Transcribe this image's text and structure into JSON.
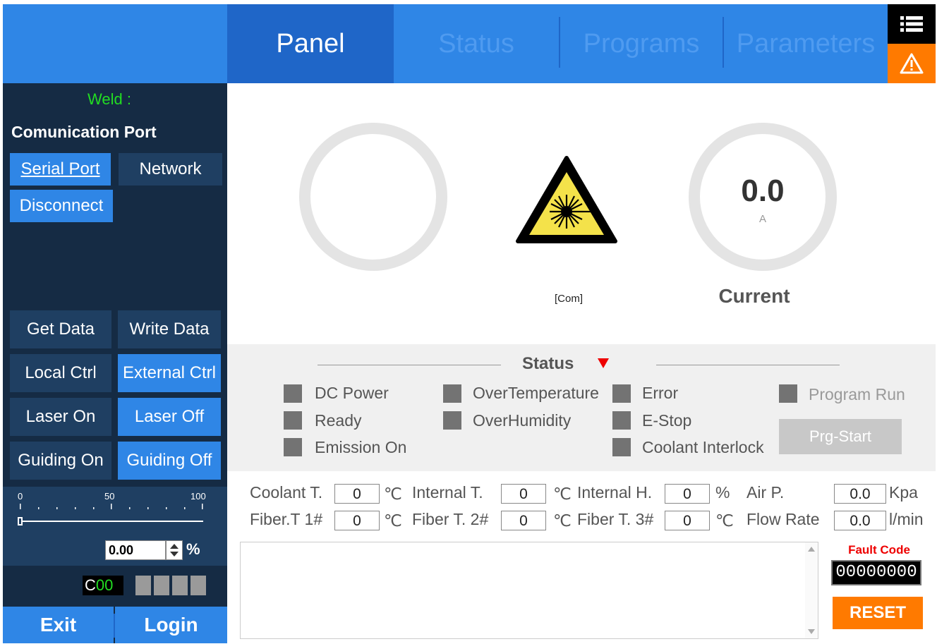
{
  "tabs": {
    "panel": "Panel",
    "status": "Status",
    "programs": "Programs",
    "parameters": "Parameters"
  },
  "icons": {
    "menu": "list-icon",
    "warning": "warning-icon",
    "laser": "laser-hazard-icon",
    "spin": "spin-up-down-icon"
  },
  "sidebar": {
    "weld_label": "Weld :",
    "comm_title": "Comunication Port",
    "serial_port": "Serial Port",
    "network": "Network",
    "disconnect": "Disconnect",
    "get_data": "Get Data",
    "write_data": "Write Data",
    "local_ctrl": "Local Ctrl",
    "external_ctrl": "External Ctrl",
    "laser_on": "Laser On",
    "laser_off": "Laser Off",
    "guiding_on": "Guiding On",
    "guiding_off": "Guiding Off",
    "slider": {
      "tick_0": "0",
      "tick_50": "50",
      "tick_100": "100",
      "value": 0,
      "spin_value": "0.00",
      "unit": "%"
    },
    "code": {
      "prefix": "C",
      "value": "00"
    },
    "exit": "Exit",
    "login": "Login"
  },
  "main": {
    "current_value": "0.0",
    "current_unit": "A",
    "current_label": "Current",
    "com_label": "[Com]",
    "status": {
      "title": "Status",
      "indicators": {
        "dc_power": "DC Power",
        "ready": "Ready",
        "emission_on": "Emission On",
        "over_temperature": "OverTemperature",
        "over_humidity": "OverHumidity",
        "error": "Error",
        "e_stop": "E-Stop",
        "coolant_interlock": "Coolant Interlock",
        "program_run": "Program Run"
      },
      "prg_start": "Prg-Start"
    },
    "measurements": {
      "coolant_t": {
        "label": "Coolant T.",
        "value": "0",
        "unit": "℃"
      },
      "internal_t": {
        "label": "Internal T.",
        "value": "0",
        "unit": "℃"
      },
      "internal_h": {
        "label": "Internal H.",
        "value": "0",
        "unit": "%"
      },
      "air_p": {
        "label": "Air P.",
        "value": "0.0",
        "unit": "Kpa"
      },
      "fiber_t1": {
        "label": "Fiber.T 1#",
        "value": "0",
        "unit": "℃"
      },
      "fiber_t2": {
        "label": "Fiber T. 2#",
        "value": "0",
        "unit": "℃"
      },
      "fiber_t3": {
        "label": "Fiber T. 3#",
        "value": "0",
        "unit": "℃"
      },
      "flow_rate": {
        "label": "Flow Rate",
        "value": "0.0",
        "unit": "l/min"
      }
    },
    "fault_code_label": "Fault Code",
    "fault_code_value": "00000000",
    "reset": "RESET"
  },
  "colors": {
    "accent": "#2f86e6",
    "tab_active": "#1f66c8",
    "sidebar_bg": "#152b44",
    "warning": "#ff7a00",
    "indicator_off": "#737373",
    "weld_label": "#22dd22",
    "fault_label": "#ee0000"
  }
}
